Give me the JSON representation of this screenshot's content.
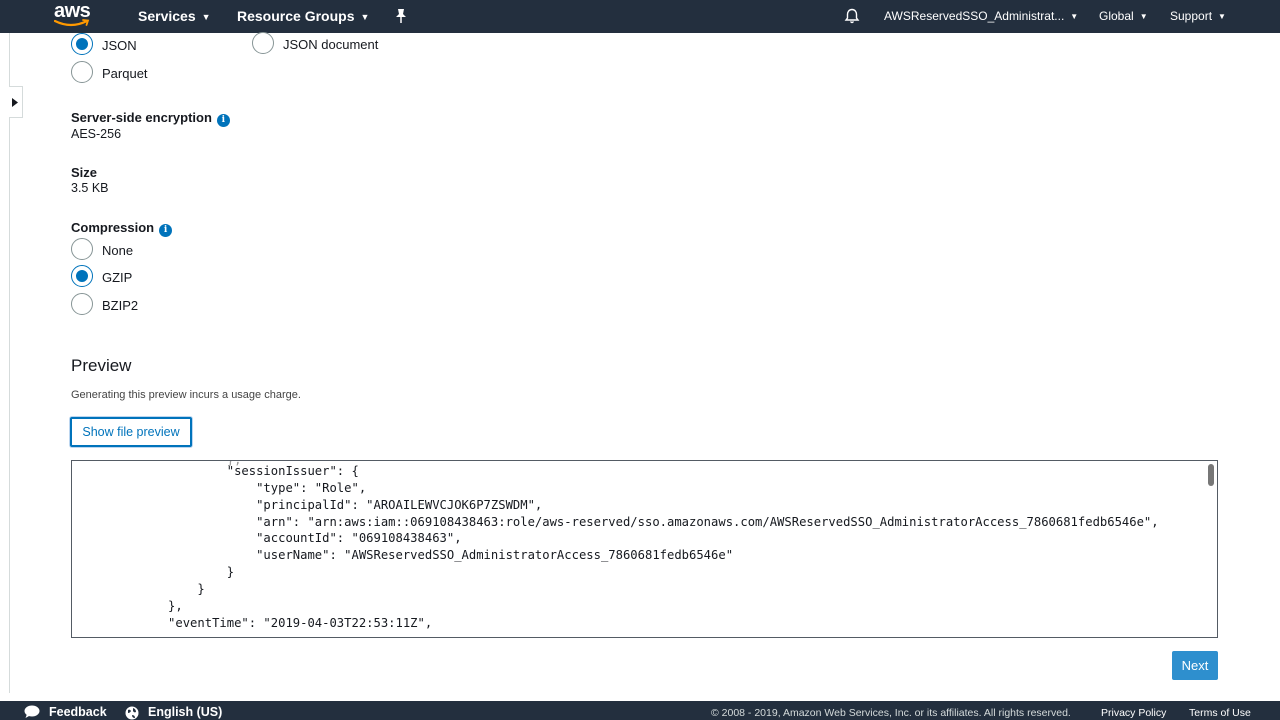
{
  "header": {
    "logo_text": "aws",
    "services_label": "Services",
    "resource_groups_label": "Resource Groups",
    "account_label": "AWSReservedSSO_Administrat...",
    "region_label": "Global",
    "support_label": "Support"
  },
  "format": {
    "options": [
      {
        "label": "JSON",
        "checked": true
      },
      {
        "label": "JSON document",
        "checked": false
      },
      {
        "label": "Parquet",
        "checked": false
      }
    ]
  },
  "encryption": {
    "label": "Server-side encryption",
    "value": "AES-256"
  },
  "size": {
    "label": "Size",
    "value": "3.5 KB"
  },
  "compression": {
    "label": "Compression",
    "options": [
      {
        "label": "None",
        "checked": false
      },
      {
        "label": "GZIP",
        "checked": true
      },
      {
        "label": "BZIP2",
        "checked": false
      }
    ]
  },
  "preview": {
    "title": "Preview",
    "description": "Generating this preview incurs a usage charge.",
    "button_label": "Show file preview",
    "code_lines": [
      {
        "indent": 0,
        "text": "                    \"sessionIssuer\": {"
      },
      {
        "indent": 0,
        "text": "                        \"type\": \"Role\","
      },
      {
        "indent": 0,
        "text": "                        \"principalId\": \"AROAILEWVCJOK6P7ZSWDM\","
      },
      {
        "indent": 0,
        "text": "                        \"arn\": \"arn:aws:iam::069108438463:role/aws-reserved/sso.amazonaws.com/AWSReservedSSO_AdministratorAccess_7860681fedb6546e\","
      },
      {
        "indent": 0,
        "text": "                        \"accountId\": \"069108438463\","
      },
      {
        "indent": 0,
        "text": "                        \"userName\": \"AWSReservedSSO_AdministratorAccess_7860681fedb6546e\""
      },
      {
        "indent": 0,
        "text": "                    }"
      },
      {
        "indent": 0,
        "text": "                }"
      },
      {
        "indent": 0,
        "text": "            },"
      },
      {
        "indent": 0,
        "text": "            \"eventTime\": \"2019-04-03T22:53:11Z\","
      }
    ]
  },
  "actions": {
    "next_label": "Next"
  },
  "footer": {
    "feedback_label": "Feedback",
    "language_label": "English (US)",
    "copyright": "© 2008 - 2019, Amazon Web Services, Inc. or its affiliates. All rights reserved.",
    "privacy_label": "Privacy Policy",
    "terms_label": "Terms of Use"
  }
}
